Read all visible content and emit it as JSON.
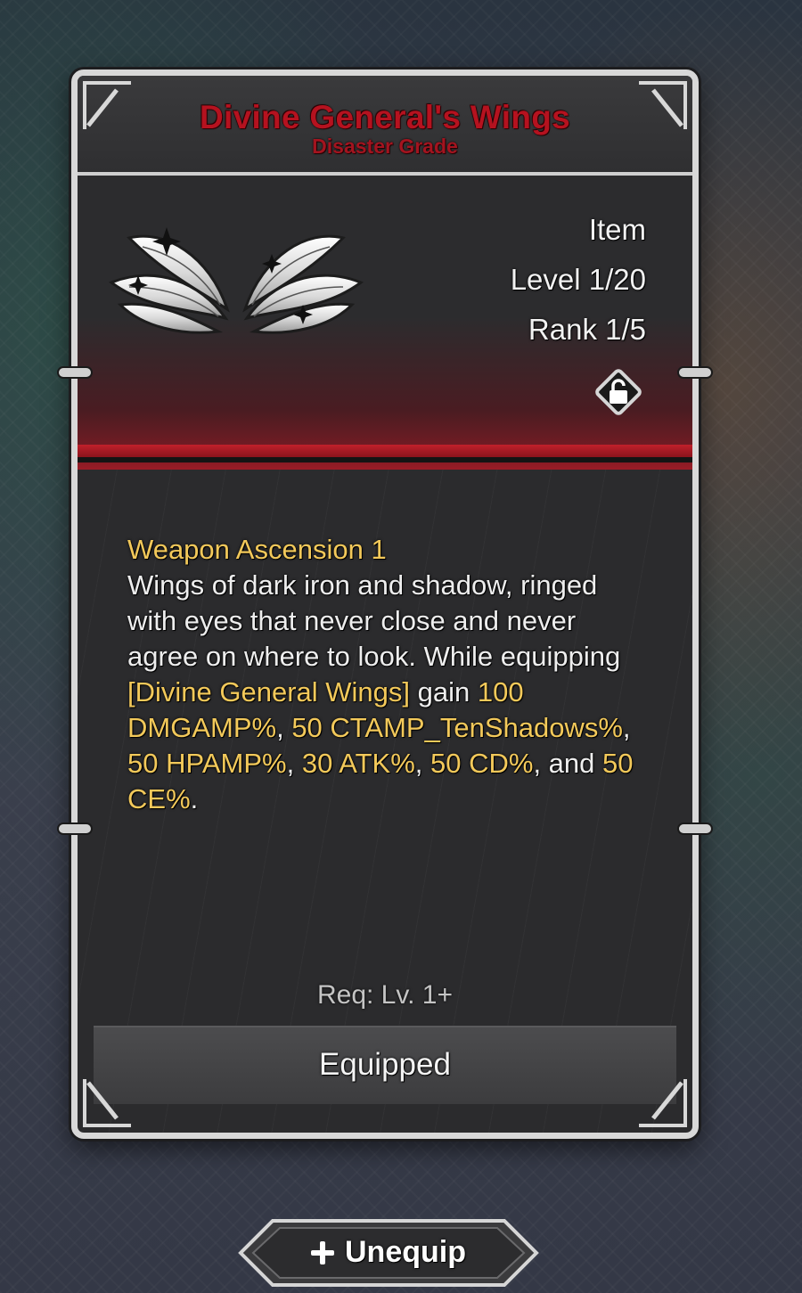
{
  "item": {
    "name": "Divine General's Wings",
    "grade": "Disaster Grade",
    "type": "Item",
    "level": "Level 1/20",
    "rank": "Rank 1/5",
    "icon": "wings-icon",
    "lock_icon": "unlocked-padlock-icon"
  },
  "description": {
    "heading": "Weapon Ascension 1",
    "lore": "Wings of dark iron and shadow, ringed with eyes that never close and never agree on where to look.",
    "effect_prefix": "While equipping ",
    "effect_target": "[Divine General Wings]",
    "effect_gain": " gain ",
    "bonus_1": "100 DMGAMP%",
    "sep_1": ", ",
    "bonus_2": "50 CTAMP_TenShadows%",
    "sep_2": ", ",
    "bonus_3": "50 HPAMP%",
    "sep_3": ", ",
    "bonus_4": "30 ATK%",
    "sep_4": ", ",
    "bonus_5": "50 CD%",
    "sep_5": ", and ",
    "bonus_6": "50 CE%",
    "end": "."
  },
  "requirement": "Req: Lv. 1+",
  "status": "Equipped",
  "actions": {
    "unequip_label": "Unequip",
    "unequip_icon": "plus-icon"
  },
  "colors": {
    "title_red": "#b5121f",
    "accent_gold": "#f3c95a",
    "band_red": "#c0202b",
    "frame": "#d8d8d8"
  }
}
